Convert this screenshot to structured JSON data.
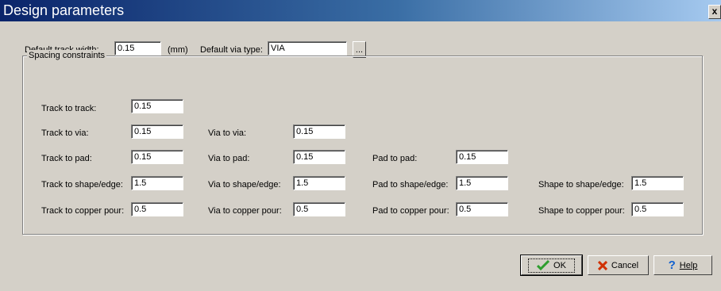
{
  "window": {
    "title": "Design parameters",
    "close_label": "x"
  },
  "top": {
    "track_width_label": "Default track width:",
    "track_width_value": "0.15",
    "unit_label": "(mm)",
    "via_type_label": "Default via type:",
    "via_type_value": "VIA",
    "browse_label": "..."
  },
  "spacing": {
    "legend": "Spacing constraints",
    "rows": [
      [
        {
          "label": "Track to track:",
          "value": "0.15"
        }
      ],
      [
        {
          "label": "Track to via:",
          "value": "0.15"
        },
        {
          "label": "Via to via:",
          "value": "0.15"
        }
      ],
      [
        {
          "label": "Track to pad:",
          "value": "0.15"
        },
        {
          "label": "Via to pad:",
          "value": "0.15"
        },
        {
          "label": "Pad to pad:",
          "value": "0.15"
        }
      ],
      [
        {
          "label": "Track to shape/edge:",
          "value": "1.5"
        },
        {
          "label": "Via to shape/edge:",
          "value": "1.5"
        },
        {
          "label": "Pad to shape/edge:",
          "value": "1.5"
        },
        {
          "label": "Shape to shape/edge:",
          "value": "1.5"
        }
      ],
      [
        {
          "label": "Track to copper pour:",
          "value": "0.5"
        },
        {
          "label": "Via to copper pour:",
          "value": "0.5"
        },
        {
          "label": "Pad to copper pour:",
          "value": "0.5"
        },
        {
          "label": "Shape to copper pour:",
          "value": "0.5"
        }
      ]
    ]
  },
  "buttons": {
    "ok": "OK",
    "cancel": "Cancel",
    "help": "Help"
  },
  "icons": {
    "ok": "checkmark-icon",
    "cancel": "x-icon",
    "help": "question-icon"
  },
  "colors": {
    "titlebar_start": "#0a246a",
    "titlebar_end": "#a6caf0",
    "face": "#d4d0c8",
    "ok_green": "#2e9e2e",
    "cancel_red": "#d03000",
    "help_blue": "#1060d0"
  }
}
